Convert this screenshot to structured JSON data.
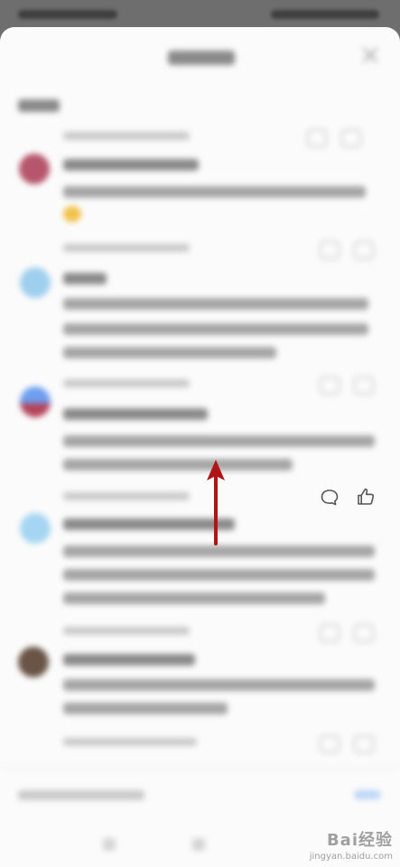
{
  "watermark": {
    "brand": "Bai经验",
    "url": "jingyan.baidu.com"
  },
  "icons": {
    "reply": "speech-bubble-icon",
    "like": "thumbs-up-icon",
    "close": "close-icon"
  },
  "colors": {
    "arrow": "#b01515",
    "sheet": "#fbfbfb",
    "overlay": "#6f6f6f"
  }
}
